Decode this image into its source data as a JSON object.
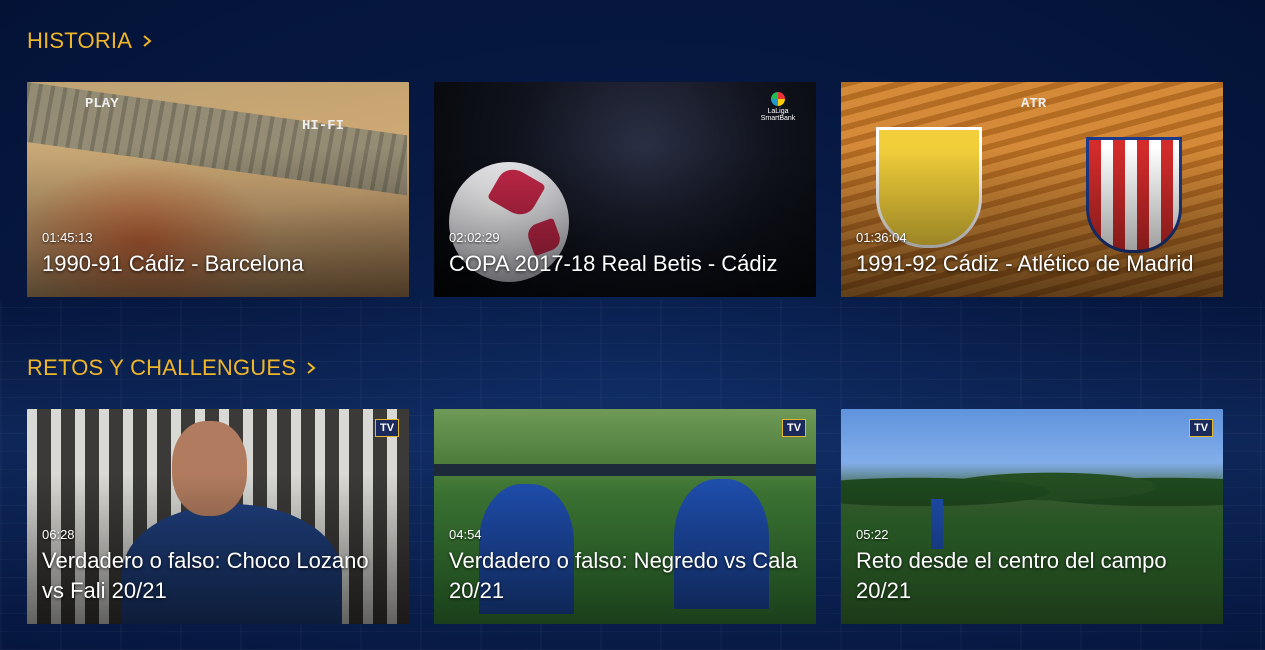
{
  "sections": [
    {
      "title": "HISTORIA",
      "cards": [
        {
          "duration": "01:45:13",
          "title": "1990-91 Cádiz - Barcelona",
          "vhs_left": "PLAY",
          "vhs_right": "HI-FI"
        },
        {
          "duration": "02:02:29",
          "title": "COPA 2017-18 Real Betis - Cádiz",
          "brand_top": "LaLiga",
          "brand_bottom": "SmartBank"
        },
        {
          "duration": "01:36:04",
          "title": "1991-92 Cádiz - Atlético de Madrid",
          "vhs_right": "ATR"
        }
      ]
    },
    {
      "title": "RETOS Y CHALLENGUES",
      "cards": [
        {
          "duration": "06:28",
          "title": "Verdadero o falso: Choco Lozano vs Fali 20/21",
          "badge": "TV"
        },
        {
          "duration": "04:54",
          "title": "Verdadero o falso: Negredo vs Cala 20/21",
          "badge": "TV"
        },
        {
          "duration": "05:22",
          "title": "Reto desde el centro del campo 20/21",
          "badge": "TV"
        }
      ]
    }
  ],
  "colors": {
    "accent": "#f0b628",
    "background": "#041236"
  }
}
